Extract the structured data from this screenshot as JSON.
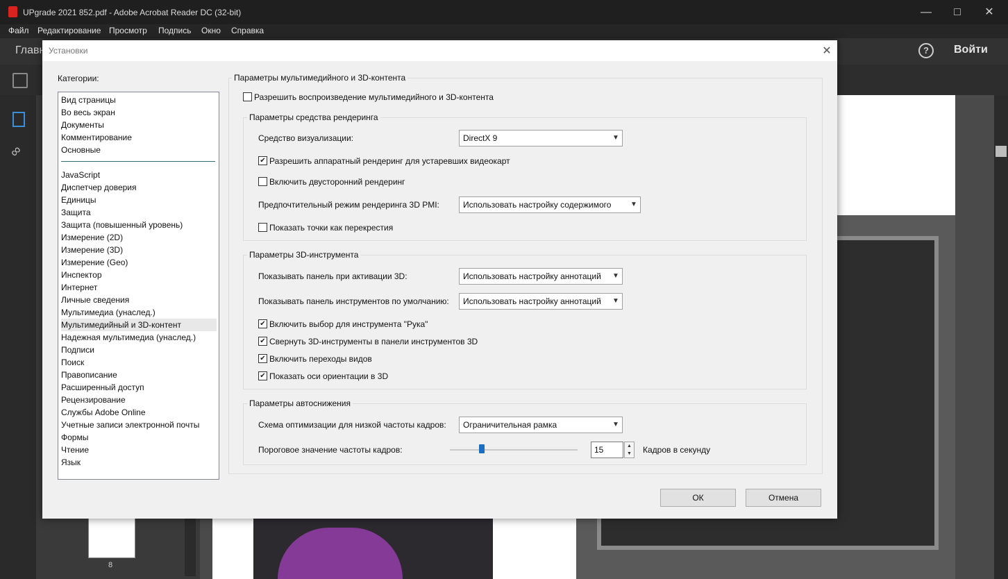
{
  "app": {
    "window_title": "UPgrade 2021 852.pdf - Adobe Acrobat Reader DC (32-bit)",
    "menu": [
      "Файл",
      "Редактирование",
      "Просмотр",
      "Подпись",
      "Окно",
      "Справка"
    ],
    "home_tab": "Главн",
    "sign_in": "Войти",
    "help_icon": "?",
    "thumb_page_number": "8"
  },
  "dialog": {
    "title": "Установки",
    "categories_label": "Категории:",
    "categories_top": [
      "Вид страницы",
      "Во весь экран",
      "Документы",
      "Комментирование",
      "Основные"
    ],
    "categories": [
      "JavaScript",
      "Диспетчер доверия",
      "Единицы",
      "Защита",
      "Защита (повышенный уровень)",
      "Измерение (2D)",
      "Измерение (3D)",
      "Измерение (Geo)",
      "Инспектор",
      "Интернет",
      "Личные сведения",
      "Мультимедиа (унаслед.)",
      "Мультимедийный и 3D-контент",
      "Надежная мультимедиа (унаслед.)",
      "Подписи",
      "Поиск",
      "Правописание",
      "Расширенный доступ",
      "Рецензирование",
      "Службы Adobe Online",
      "Учетные записи электронной почты",
      "Формы",
      "Чтение",
      "Язык"
    ],
    "selected_category": "Мультимедийный и 3D-контент",
    "main_group_title": "Параметры мультимедийного и 3D-контента",
    "enable_playback": {
      "label": "Разрешить воспроизведение мультимедийного и 3D-контента",
      "checked": false
    },
    "render": {
      "title": "Параметры средства рендеринга",
      "renderer_label": "Средство визуализации:",
      "renderer_value": "DirectX 9",
      "legacy_hw": {
        "label": "Разрешить аппаратный рендеринг для устаревших видеокарт",
        "checked": true
      },
      "double_sided": {
        "label": "Включить двусторонний рендеринг",
        "checked": false
      },
      "pmi_label": "Предпочтительный режим рендеринга 3D PMI:",
      "pmi_value": "Использовать настройку содержимого",
      "points_cross": {
        "label": "Показать точки как перекрестия",
        "checked": false
      }
    },
    "tool3d": {
      "title": "Параметры 3D-инструмента",
      "panel_on_activate_label": "Показывать панель при активации 3D:",
      "panel_on_activate_value": "Использовать настройку аннотаций",
      "toolbar_default_label": "Показывать панель инструментов по умолчанию:",
      "toolbar_default_value": "Использовать настройку аннотаций",
      "hand_select": {
        "label": "Включить выбор для инструмента \"Рука\"",
        "checked": true
      },
      "collapse_tools": {
        "label": "Свернуть 3D-инструменты в панели инструментов 3D",
        "checked": true
      },
      "view_transitions": {
        "label": "Включить переходы видов",
        "checked": true
      },
      "show_axes": {
        "label": "Показать оси ориентации в 3D",
        "checked": true
      }
    },
    "autoreduce": {
      "title": "Параметры автоснижения",
      "scheme_label": "Схема оптимизации для низкой частоты кадров:",
      "scheme_value": "Ограничительная рамка",
      "threshold_label": "Пороговое значение частоты кадров:",
      "threshold_value": "15",
      "threshold_unit": "Кадров в секунду",
      "slider_fraction": 0.25
    },
    "ok": "ОК",
    "cancel": "Отмена"
  }
}
